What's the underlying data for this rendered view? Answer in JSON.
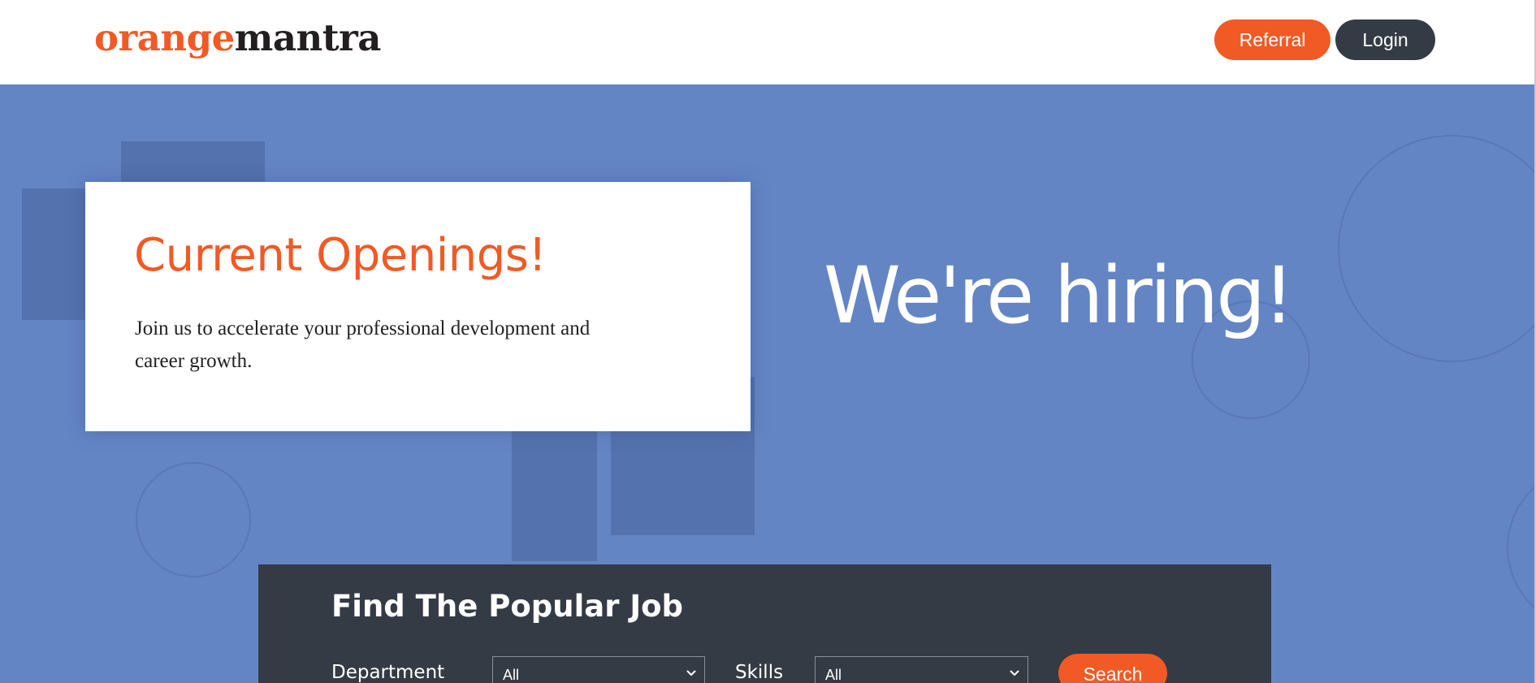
{
  "header": {
    "logo": {
      "part1": "orange",
      "part2": "mantra"
    },
    "referral_label": "Referral",
    "login_label": "Login"
  },
  "hero": {
    "card": {
      "title": "Current Openings!",
      "text": "Join us to accelerate your professional development and career growth."
    },
    "tagline": "We're hiring!"
  },
  "search_panel": {
    "title": "Find The Popular Job",
    "department": {
      "label": "Department",
      "value": "All"
    },
    "skills": {
      "label": "Skills",
      "value": "All"
    },
    "search_label": "Search"
  },
  "colors": {
    "brand_orange": "#f15a24",
    "dark": "#353b44",
    "hero_blue": "#6485c4"
  }
}
